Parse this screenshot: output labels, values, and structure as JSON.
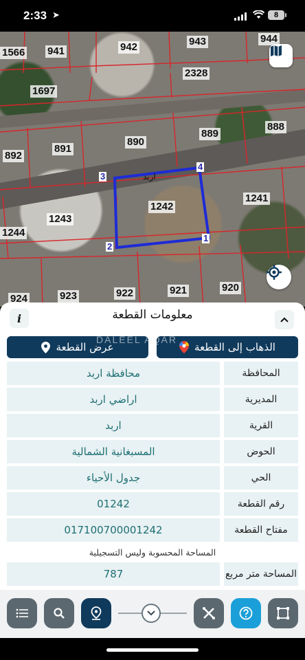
{
  "status_bar": {
    "time": "2:33",
    "battery": "8"
  },
  "map": {
    "plots": [
      {
        "id": "p1566",
        "label": "1566"
      },
      {
        "id": "p941",
        "label": "941"
      },
      {
        "id": "p942",
        "label": "942"
      },
      {
        "id": "p943",
        "label": "943"
      },
      {
        "id": "p944",
        "label": "944"
      },
      {
        "id": "p2328",
        "label": "2328"
      },
      {
        "id": "p1697",
        "label": "1697"
      },
      {
        "id": "p890",
        "label": "890"
      },
      {
        "id": "p889",
        "label": "889"
      },
      {
        "id": "p888",
        "label": "888"
      },
      {
        "id": "p892",
        "label": "892"
      },
      {
        "id": "p891",
        "label": "891"
      },
      {
        "id": "p1242",
        "label": "1242"
      },
      {
        "id": "p1241",
        "label": "1241"
      },
      {
        "id": "p1243",
        "label": "1243"
      },
      {
        "id": "p1244",
        "label": "1244"
      },
      {
        "id": "p924",
        "label": "924"
      },
      {
        "id": "p923",
        "label": "923"
      },
      {
        "id": "p922",
        "label": "922"
      },
      {
        "id": "p921",
        "label": "921"
      },
      {
        "id": "p920",
        "label": "920"
      }
    ],
    "corners": [
      "1",
      "2",
      "3",
      "4"
    ],
    "village_tag": "اربد"
  },
  "panel": {
    "title": "معلومات القطعة",
    "info_label": "i",
    "go_to_plot": "الذهاب إلى القطعة",
    "show_plot": "عرض القطعة",
    "watermark": "DALEEL AQAR",
    "rows": [
      {
        "label": "المحافظة",
        "value": "محافظة اربد"
      },
      {
        "label": "المديرية",
        "value": "اراضي اربد"
      },
      {
        "label": "القرية",
        "value": "اربد"
      },
      {
        "label": "الحوض",
        "value": "المسبغانية الشمالية"
      },
      {
        "label": "الحي",
        "value": "جدول الأحياء"
      },
      {
        "label": "رقم القطعة",
        "value": "01242"
      },
      {
        "label": "مفتاح القطعة",
        "value": "017100700001242"
      }
    ],
    "area_note": "المساحة المحسوبة وليس التسجيلية",
    "area_row": {
      "label": "المساحة متر مربع",
      "value": "787"
    }
  },
  "toolbar": {
    "buttons": [
      "list-icon",
      "search-icon",
      "location-pin-icon",
      "measure-icon",
      "help-icon",
      "polygon-icon"
    ]
  },
  "colors": {
    "navy": "#103a5c",
    "teal_text": "#1d6f73",
    "row_bg": "#e8f1f3",
    "boundary": "#1e2bd6",
    "parcel_lines": "#d8262b"
  }
}
